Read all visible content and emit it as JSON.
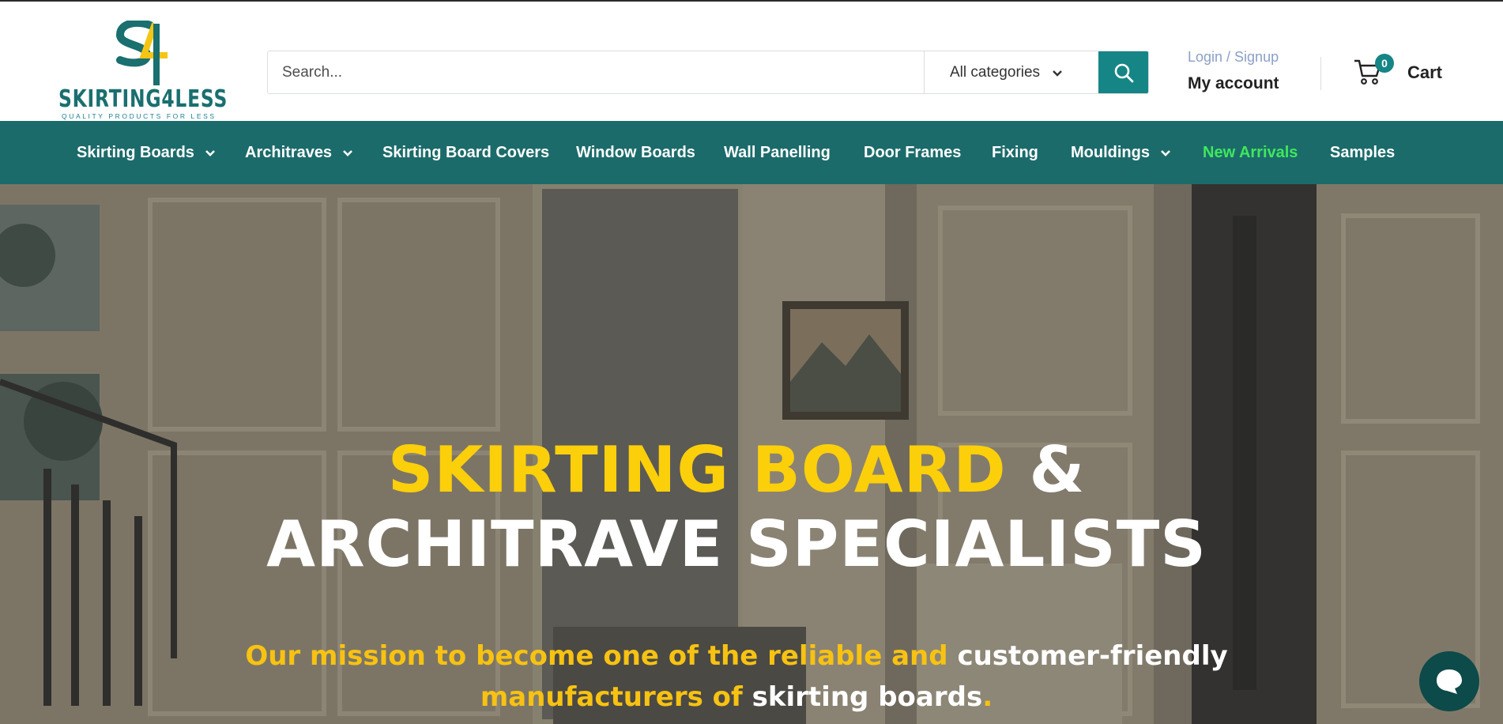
{
  "brand": {
    "name": "SKIRTING4LESS",
    "tagline": "QUALITY PRODUCTS FOR LESS",
    "mark": "S4",
    "colors": {
      "teal": "#1c6b6b",
      "accent_teal": "#168585",
      "yellow": "#fccf0b"
    }
  },
  "search": {
    "placeholder": "Search...",
    "category_label": "All categories",
    "button_icon": "search-icon"
  },
  "account": {
    "login_label": "Login / Signup",
    "my_account_label": "My account"
  },
  "cart": {
    "count": "0",
    "label": "Cart",
    "icon": "cart-icon"
  },
  "nav": {
    "items": [
      {
        "label": "Skirting Boards",
        "dropdown": true
      },
      {
        "label": "Architraves",
        "dropdown": true
      },
      {
        "label": "Skirting Board Covers",
        "dropdown": false
      },
      {
        "label": "Window Boards",
        "dropdown": false
      },
      {
        "label": "Wall Panelling",
        "dropdown": false
      },
      {
        "label": "Door Frames",
        "dropdown": false
      },
      {
        "label": "Fixing",
        "dropdown": false
      },
      {
        "label": "Mouldings",
        "dropdown": true
      },
      {
        "label": "New Arrivals",
        "dropdown": false,
        "highlight_color": "#3ee85c"
      },
      {
        "label": "Samples",
        "dropdown": false
      }
    ]
  },
  "hero": {
    "title_part1": "SKIRTING BOARD",
    "title_part2": "&",
    "title_part3": "ARCHITRAVE SPECIALISTS",
    "subtitle_part1": "Our mission to become one of the reliable and",
    "subtitle_part2": "customer-friendly",
    "subtitle_part3": "manufacturers of",
    "subtitle_part4": "skirting boards",
    "subtitle_part5": "."
  },
  "chat": {
    "icon": "chat-bubble-icon"
  }
}
